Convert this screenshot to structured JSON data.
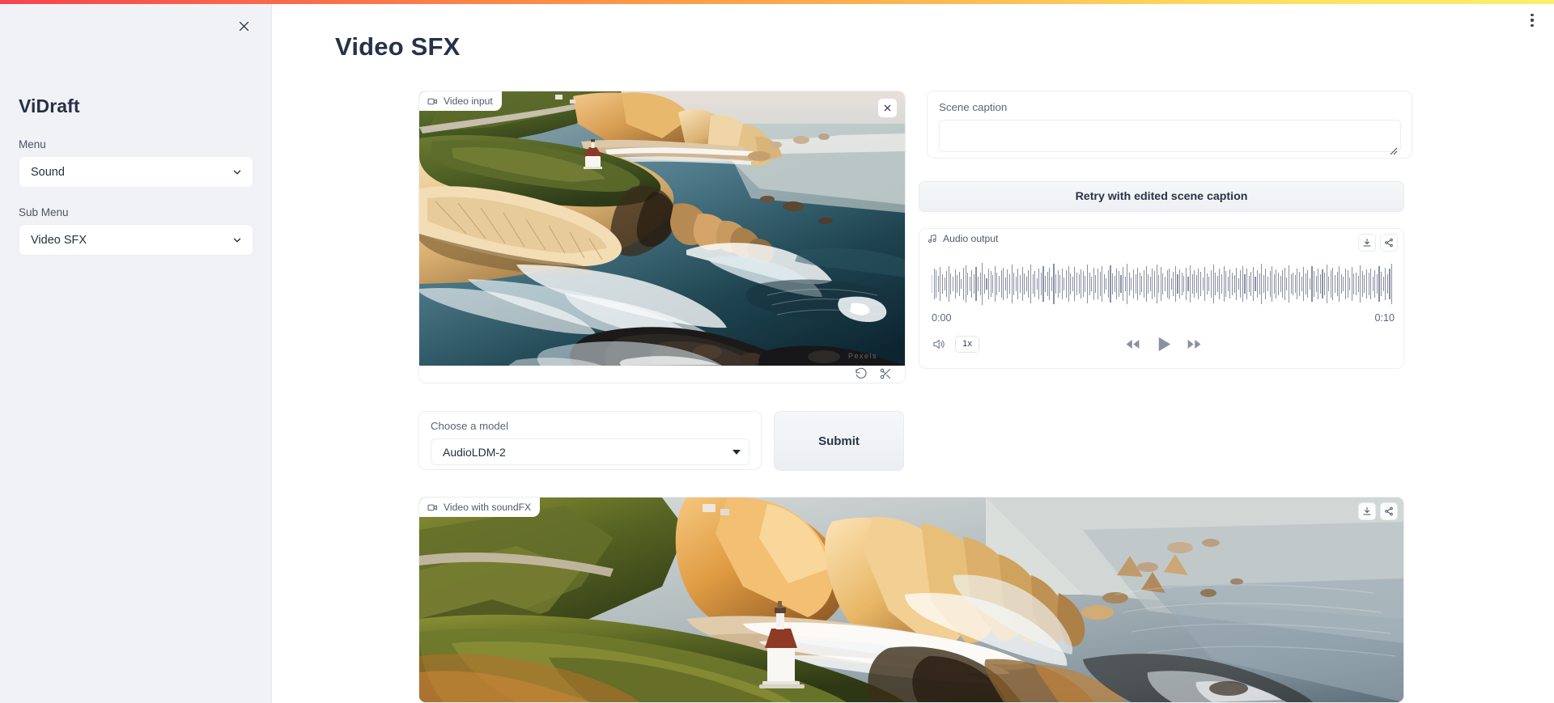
{
  "topbar": {
    "gradient_from": "#f5444f",
    "gradient_to": "#fcef6a"
  },
  "header": {
    "kebab_icon": "more-vertical-icon",
    "page_title": "Video SFX"
  },
  "sidebar": {
    "close_icon": "close-icon",
    "brand": "ViDraft",
    "groups": [
      {
        "label": "Menu",
        "value": "Sound",
        "icon": "chevron-down-icon"
      },
      {
        "label": "Sub Menu",
        "value": "Video SFX",
        "icon": "chevron-down-icon"
      }
    ]
  },
  "video_input": {
    "tag_label": "Video input",
    "tag_icon": "video-camera-icon",
    "close_icon": "close-icon",
    "controls": [
      {
        "icon": "undo-rotate-ccw-icon",
        "name": "trim-reset"
      },
      {
        "icon": "scissors-icon",
        "name": "trim"
      }
    ]
  },
  "caption": {
    "label": "Scene caption",
    "value": "",
    "placeholder": "",
    "resize_icon": "resize-grip-icon"
  },
  "retry": {
    "label": "Retry with edited scene caption"
  },
  "audio_output": {
    "tag_label": "Audio output",
    "tag_icon": "music-note-icon",
    "download_icon": "download-icon",
    "share_icon": "share-icon",
    "time_start": "0:00",
    "time_end": "0:10",
    "volume_icon": "volume-icon",
    "speed_label": "1x",
    "rewind_icon": "rewind-icon",
    "play_icon": "play-icon",
    "forward_icon": "fast-forward-icon",
    "waveform": [
      30,
      52,
      46,
      28,
      58,
      34,
      22,
      44,
      60,
      36,
      26,
      50,
      30,
      42,
      18,
      56,
      64,
      38,
      24,
      48,
      32,
      58,
      26,
      40,
      72,
      34,
      20,
      52,
      44,
      30,
      62,
      38,
      28,
      46,
      56,
      22,
      50,
      34,
      68,
      40,
      24,
      54,
      30,
      58,
      36,
      26,
      48,
      66,
      32,
      44,
      20,
      52,
      38,
      60,
      28,
      42,
      56,
      24,
      70,
      34,
      46,
      30,
      54,
      22,
      48,
      62,
      36,
      26,
      58,
      40,
      32,
      50,
      44,
      28,
      66,
      38,
      24,
      56,
      30,
      52,
      42,
      60,
      34,
      20,
      48,
      64,
      36,
      28,
      54,
      44,
      30,
      58,
      26,
      70,
      38,
      22,
      50,
      32,
      56,
      40,
      28,
      46,
      62,
      34,
      24,
      52,
      44,
      68,
      30,
      58,
      36,
      26,
      48,
      54,
      20,
      42,
      60,
      32,
      50,
      38,
      28,
      56,
      24,
      64,
      34,
      46,
      30,
      52,
      42,
      22,
      58,
      36,
      26,
      48,
      66,
      40,
      28,
      54,
      32,
      60,
      44,
      24,
      50,
      38,
      30,
      56,
      20,
      46,
      62,
      34,
      52,
      28,
      42,
      58,
      26,
      48,
      36,
      70,
      30,
      54,
      24,
      44,
      60,
      32,
      50,
      38,
      28,
      46,
      56,
      22,
      64,
      34,
      40,
      30,
      52,
      42,
      26,
      58,
      36,
      48,
      20,
      62,
      44,
      28,
      54,
      32,
      50,
      38,
      66,
      24,
      46,
      56,
      30,
      42,
      60,
      34,
      26,
      52,
      48,
      22,
      58,
      36,
      40,
      28,
      64,
      44,
      30,
      50,
      38,
      54,
      24,
      46,
      32,
      60,
      42,
      26,
      56,
      34,
      52,
      70
    ]
  },
  "model": {
    "label": "Choose a model",
    "value": "AudioLDM-2",
    "caret_icon": "caret-down-icon"
  },
  "submit": {
    "label": "Submit"
  },
  "video_sfx": {
    "tag_label": "Video with soundFX",
    "tag_icon": "video-camera-icon",
    "download_icon": "download-icon",
    "share_icon": "share-icon"
  }
}
